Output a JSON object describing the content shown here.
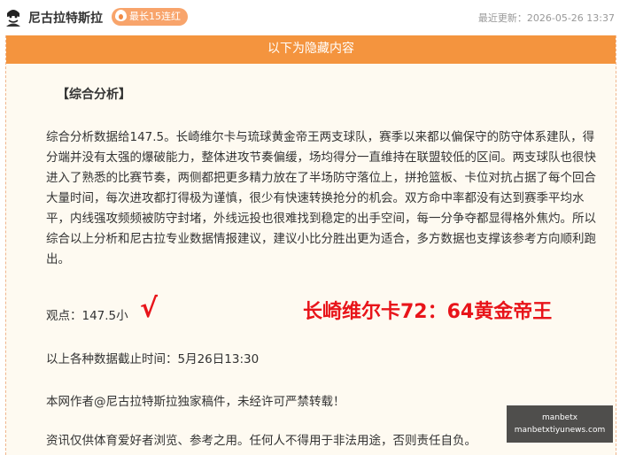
{
  "header": {
    "author": "尼古拉特斯拉",
    "streak_badge": "最长15连红",
    "last_update": "最近更新：2026-05-26 13:37"
  },
  "hidden_bar": "以下为隐藏内容",
  "article": {
    "section_title": "【综合分析】",
    "analysis": "综合分析数据给147.5。长崎维尔卡与琉球黄金帝王两支球队，赛季以来都以偏保守的防守体系建队，得分端并没有太强的爆破能力，整体进攻节奏偏缓，场均得分一直维持在联盟较低的区间。两支球队也很快进入了熟悉的比赛节奏，两侧都把更多精力放在了半场防守落位上，拼抢篮板、卡位对抗占据了每个回合大量时间，每次进攻都打得极为谨慎，很少有快速转换抢分的机会。双方命中率都没有达到赛季平均水平，内线强攻频频被防守封堵，外线远投也很难找到稳定的出手空间，每一分争夺都显得格外焦灼。所以综合以上分析和尼古拉专业数据情报建议，建议小比分胜出更为适合，多方数据也支撑该参考方向顺利跑出。",
    "viewpoint": "观点：147.5小",
    "check_mark": "√",
    "prediction": "长崎维尔卡72：64黄金帝王",
    "deadline": "以上各种数据截止时间：5月26日13:30",
    "copyright": "本网作者@尼古拉特斯拉独家稿件，未经许可严禁转载！",
    "disclaimer": "资讯仅供体育爱好者浏览、参考之用。任何人不得用于非法用途，否则责任自负。"
  },
  "watermark": {
    "line1": "manbetx",
    "line2": "manbetxtiyunews.com"
  },
  "colors": {
    "accent_orange": "#f4943e",
    "badge_orange": "#f8a46b",
    "prediction_red": "#e8141a",
    "panel_bg": "#fefaf1"
  },
  "icons": {
    "avatar": "avatar-icon",
    "flame": "flame-icon"
  }
}
